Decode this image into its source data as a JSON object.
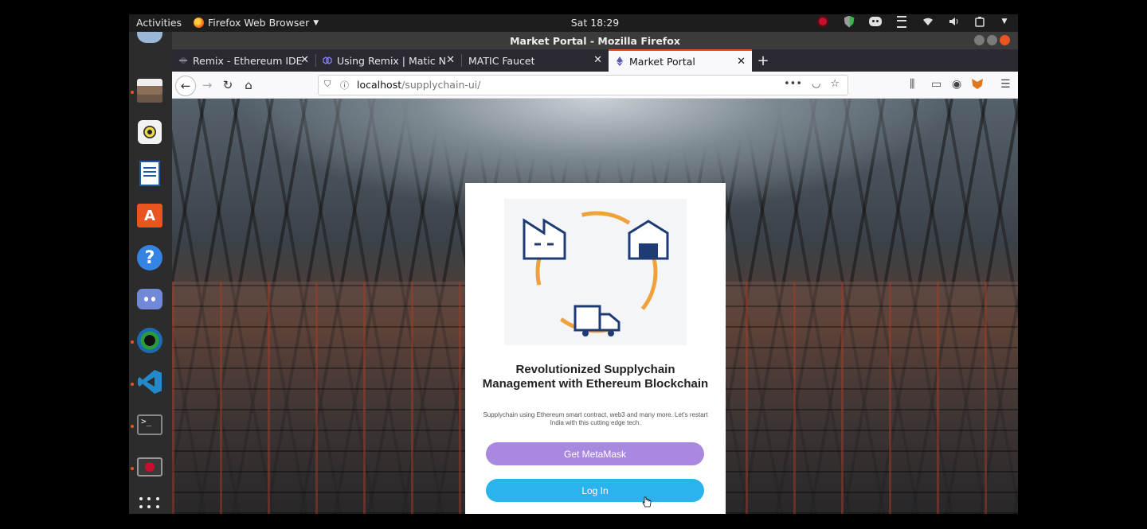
{
  "system": {
    "activities_label": "Activities",
    "app_menu_label": "Firefox Web Browser",
    "clock": "Sat 18:29"
  },
  "window": {
    "title": "Market Portal - Mozilla Firefox"
  },
  "tabs": [
    {
      "label": "Remix - Ethereum IDE",
      "icon": "remix-icon"
    },
    {
      "label": "Using Remix | Matic Netw",
      "icon": "matic-icon"
    },
    {
      "label": "MATIC Faucet",
      "icon": ""
    },
    {
      "label": "Market Portal",
      "icon": "ethereum-icon",
      "active": true
    }
  ],
  "navbar": {
    "url_host": "localhost",
    "url_path": "/supplychain-ui/"
  },
  "card": {
    "title": "Revolutionized Supplychain Management with Ethereum Blockchain",
    "description": "Supplychain using Ethereum smart contract, web3 and many more. Let's restart India with this cutting edge tech.",
    "metamask_button": "Get MetaMask",
    "login_button": "Log In"
  },
  "colors": {
    "accent_orange": "#e95420",
    "metamask_button": "#a988e0",
    "login_button": "#2bb3ee",
    "illustration_navy": "#1f3b73",
    "illustration_ring": "#f0a23a"
  }
}
